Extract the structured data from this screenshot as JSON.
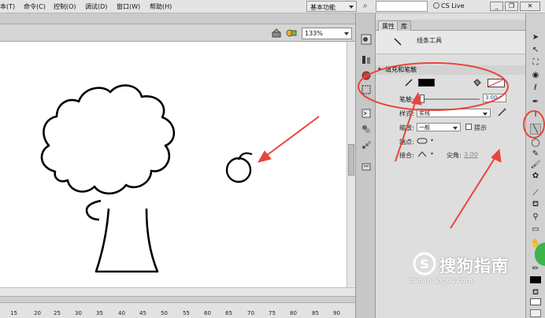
{
  "menubar": {
    "items": [
      "本(T)",
      "命令(C)",
      "控制(O)",
      "调试(D)",
      "窗口(W)",
      "帮助(H)"
    ],
    "workspace": "基本功能",
    "cs_live": "CS Live",
    "min": "_",
    "restore": "❐",
    "close": "✕"
  },
  "stage": {
    "zoom": "133%"
  },
  "ruler": {
    "ticks": [
      "15",
      "20",
      "25",
      "30",
      "35",
      "40",
      "45",
      "50",
      "55",
      "60",
      "65",
      "70",
      "75",
      "80",
      "85",
      "90"
    ]
  },
  "properties": {
    "tab_properties": "属性",
    "tab_library": "库",
    "tool_name": "线条工具",
    "section_fill_stroke": "填充和笔触",
    "stroke_label": "笔触:",
    "stroke_value": "3.00",
    "style_label": "样式:",
    "style_value": "实线",
    "scale_label": "缩放:",
    "scale_value": "一般",
    "hint_label": "提示",
    "cap_label": "端点:",
    "join_label": "接合:",
    "miter_label": "尖角:",
    "miter_value": "3.00",
    "stroke_ratio": 0.05
  },
  "watermark": {
    "text": "搜狗指南",
    "url": "zhinan.sogou.com"
  },
  "colors": {
    "annotation": "#e8453c",
    "stroke_color": "#000000"
  }
}
